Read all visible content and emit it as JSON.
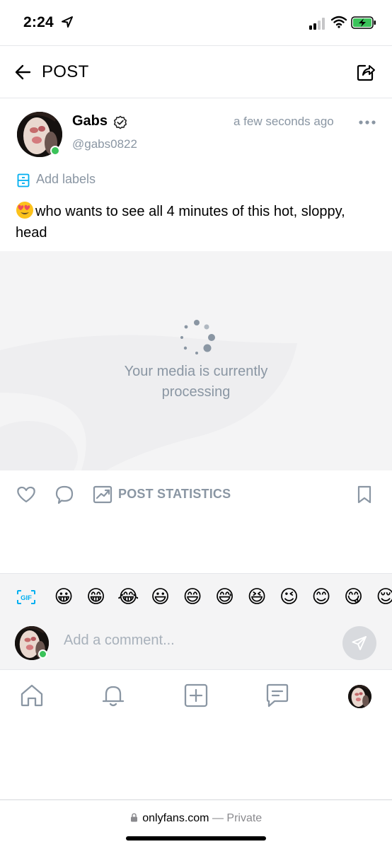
{
  "status_bar": {
    "time": "2:24",
    "accent": "#3bc35a"
  },
  "header": {
    "title": "POST"
  },
  "post": {
    "author_name": "Gabs",
    "author_handle": "@gabs0822",
    "timestamp": "a few seconds ago",
    "labels_action": "Add labels",
    "text": "who wants to see all 4 minutes of this hot, sloppy, head",
    "text_emoji": "😍",
    "media_message": "Your media is currently processing",
    "online_color": "#3bc35a"
  },
  "actions": {
    "stats_label": "POST STATISTICS"
  },
  "comment": {
    "gif_label": "GIF",
    "emojis": [
      "😀",
      "😁",
      "😂",
      "😃",
      "😄",
      "😅",
      "😆",
      "😉",
      "😊",
      "😋",
      "😌"
    ],
    "placeholder": "Add a comment..."
  },
  "nav": {
    "items": [
      "home-icon",
      "bell-icon",
      "add-post-icon",
      "messages-icon",
      "profile-avatar"
    ]
  },
  "browser": {
    "domain": "onlyfans.com",
    "mode": "— Private"
  },
  "colors": {
    "muted": "#8a96a3",
    "accent_blue": "#00aff0",
    "background_gray": "#f4f4f5"
  }
}
